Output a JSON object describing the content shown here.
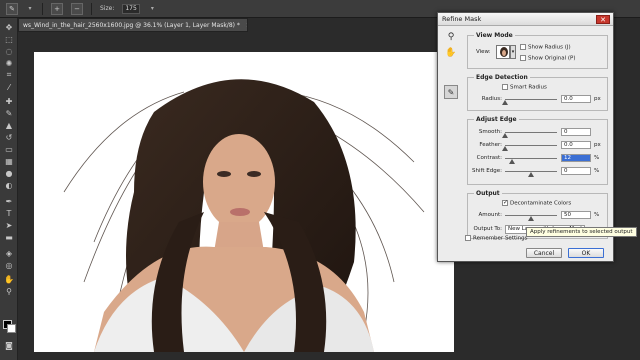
{
  "options_bar": {
    "size_label": "Size:",
    "size_value": "175"
  },
  "document": {
    "tab_title": "ws_Wind_in_the_hair_2560x1600.jpg @ 36.1% (Layer 1, Layer Mask/8) *",
    "close_symbol": "×"
  },
  "dialog": {
    "title": "Refine Mask",
    "close_symbol": "✕",
    "view_mode": {
      "title": "View Mode",
      "view_label": "View:",
      "show_radius": "Show Radius (J)",
      "show_original": "Show Original (P)"
    },
    "edge_detection": {
      "title": "Edge Detection",
      "smart_radius": "Smart Radius",
      "radius_label": "Radius:",
      "radius_value": "0.0",
      "radius_unit": "px"
    },
    "adjust_edge": {
      "title": "Adjust Edge",
      "smooth_label": "Smooth:",
      "smooth_value": "0",
      "feather_label": "Feather:",
      "feather_value": "0.0",
      "feather_unit": "px",
      "contrast_label": "Contrast:",
      "contrast_value": "12",
      "contrast_unit": "%",
      "shift_label": "Shift Edge:",
      "shift_value": "0",
      "shift_unit": "%"
    },
    "output": {
      "title": "Output",
      "decontaminate": "Decontaminate Colors",
      "amount_label": "Amount:",
      "amount_value": "50",
      "amount_unit": "%",
      "output_to_label": "Output To:",
      "output_to_value": "New Layer with Layer Mask"
    },
    "remember_settings": "Remember Settings",
    "cancel_label": "Cancel",
    "ok_label": "OK",
    "tooltip": "Apply refinements to selected output"
  },
  "icons": {
    "zoom": "zoom-icon",
    "hand": "hand-icon",
    "brush": "refine-brush-icon"
  }
}
